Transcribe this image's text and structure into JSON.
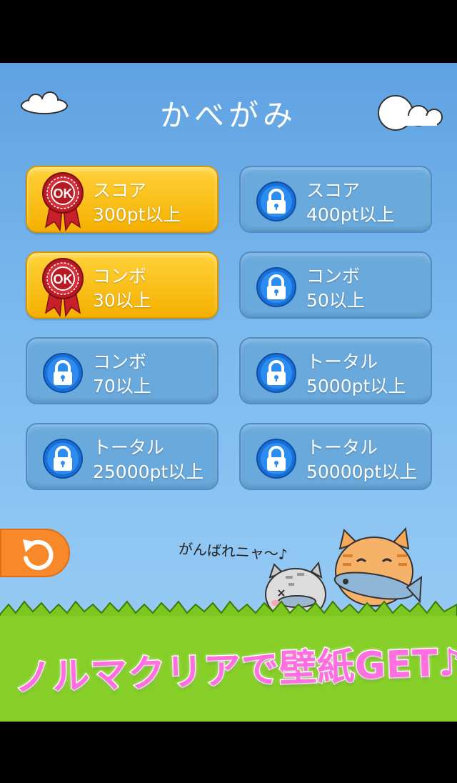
{
  "title": "かべがみ",
  "wallpapers": [
    {
      "line1": "スコア",
      "line2": "300pt以上",
      "status": "unlocked",
      "badge": "OK"
    },
    {
      "line1": "スコア",
      "line2": "400pt以上",
      "status": "locked"
    },
    {
      "line1": "コンボ",
      "line2": "30以上",
      "status": "unlocked",
      "badge": "OK"
    },
    {
      "line1": "コンボ",
      "line2": "50以上",
      "status": "locked"
    },
    {
      "line1": "コンボ",
      "line2": "70以上",
      "status": "locked"
    },
    {
      "line1": "トータル",
      "line2": "5000pt以上",
      "status": "locked"
    },
    {
      "line1": "トータル",
      "line2": "25000pt以上",
      "status": "locked"
    },
    {
      "line1": "トータル",
      "line2": "50000pt以上",
      "status": "locked"
    }
  ],
  "cheer_text": "がんばれニャ〜♪",
  "banner": "ノルマクリアで壁紙GET♪",
  "back_icon": "undo-arrow-icon",
  "colors": {
    "sky": "#7cb9ee",
    "unlocked": "#ffc61a",
    "locked": "#6aa9dc",
    "banner": "#ff6fe0",
    "back": "#f7892a",
    "grass": "#7cc61f"
  }
}
